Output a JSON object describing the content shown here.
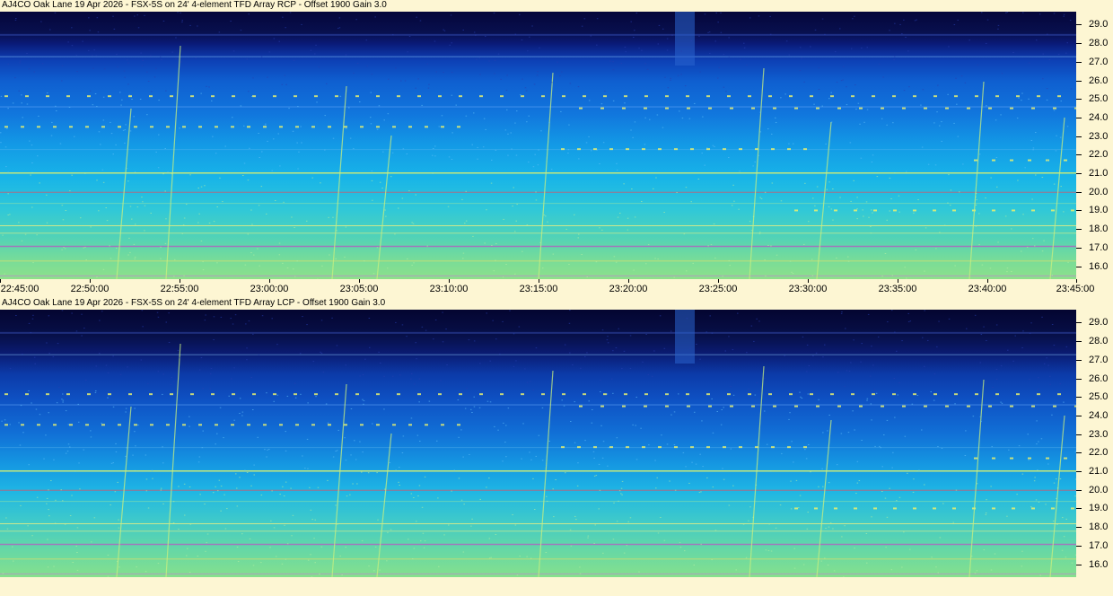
{
  "chart_data": [
    {
      "type": "heatmap",
      "title": "AJ4CO Oak Lane 19 Apr 2026 - FSX-5S on 24' 4-element TFD Array RCP  -  Offset 1900  Gain 3.0",
      "xlabel": "",
      "ylabel": "",
      "x_ticks": [
        "22:45:00",
        "22:50:00",
        "22:55:00",
        "23:00:00",
        "23:05:00",
        "23:10:00",
        "23:15:00",
        "23:20:00",
        "23:25:00",
        "23:30:00",
        "23:35:00",
        "23:40:00",
        "23:45:00"
      ],
      "y_ticks": [
        "29.0",
        "28.0",
        "27.0",
        "26.0",
        "25.0",
        "24.0",
        "23.0",
        "22.0",
        "21.0",
        "20.0",
        "19.0",
        "18.0",
        "17.0",
        "16.0"
      ],
      "ylim": [
        15.3,
        29.7
      ],
      "xlim": [
        "22:45:00",
        "23:45:00"
      ],
      "colormap": [
        "#05063a",
        "#0a1a78",
        "#0f5fd0",
        "#139ae6",
        "#30c8d8",
        "#8ee08a"
      ]
    },
    {
      "type": "heatmap",
      "title": "AJ4CO Oak Lane 19 Apr 2026 - FSX-5S on 24' 4-element TFD Array LCP  -  Offset 1900  Gain 3.0",
      "xlabel": "",
      "ylabel": "",
      "x_ticks": [],
      "y_ticks": [
        "29.0",
        "28.0",
        "27.0",
        "26.0",
        "25.0",
        "24.0",
        "23.0",
        "22.0",
        "21.0",
        "20.0",
        "19.0",
        "18.0",
        "17.0",
        "16.0"
      ],
      "ylim": [
        15.3,
        29.7
      ],
      "xlim": [
        "22:45:00",
        "23:45:00"
      ],
      "colormap": [
        "#040530",
        "#0a1a70",
        "#0e52c4",
        "#1598e2",
        "#3cc8cc",
        "#86e08c"
      ]
    }
  ]
}
